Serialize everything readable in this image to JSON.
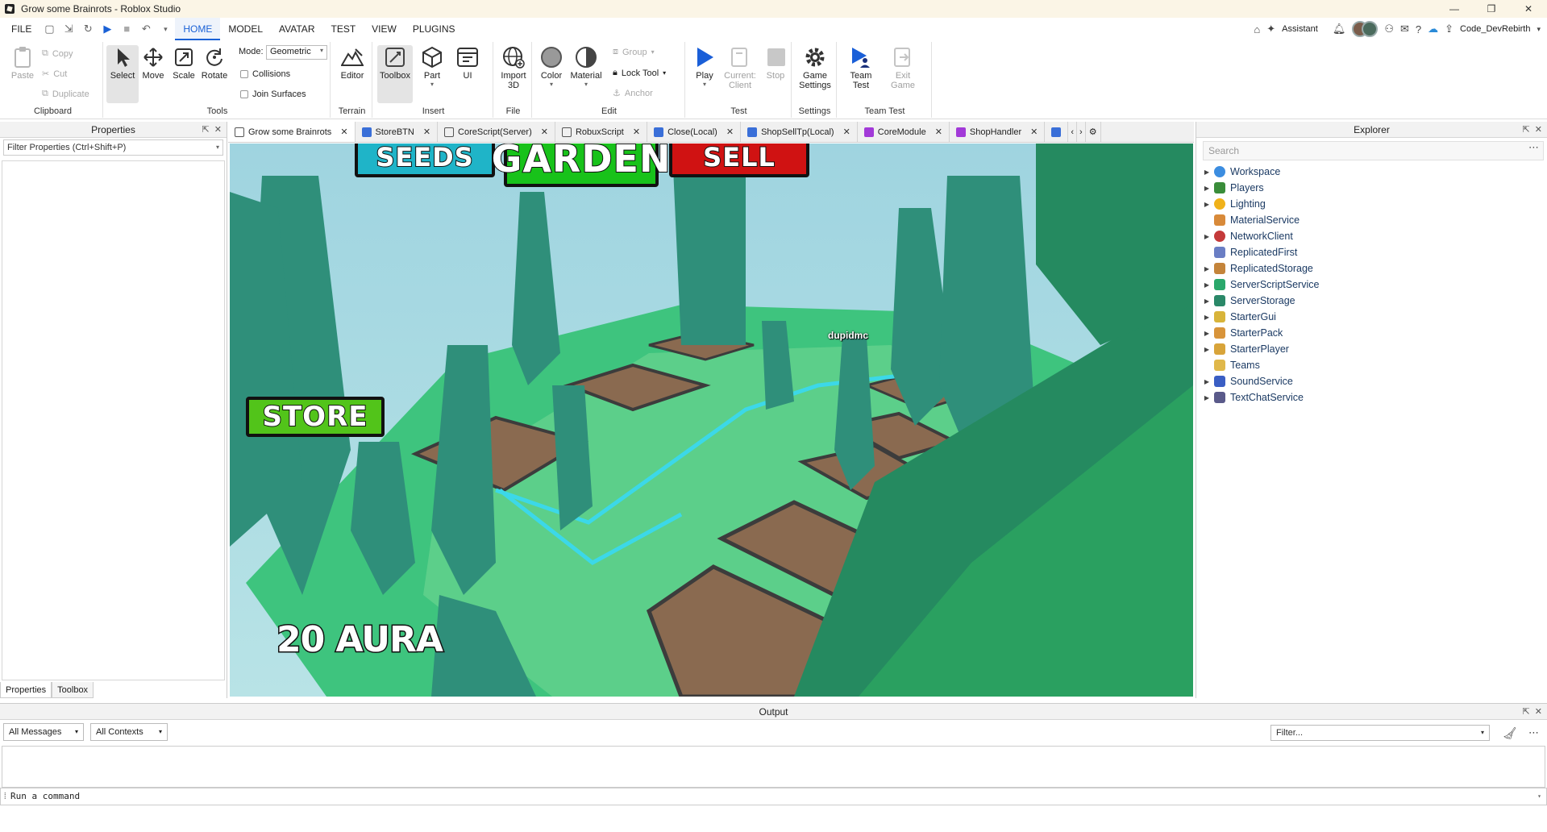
{
  "window": {
    "title": "Grow some Brainrots - Roblox Studio",
    "controls": [
      "—",
      "❐",
      "✕"
    ]
  },
  "menubar": {
    "file": "FILE",
    "tabs": [
      "HOME",
      "MODEL",
      "AVATAR",
      "TEST",
      "VIEW",
      "PLUGINS"
    ],
    "assistant": "Assistant",
    "username": "Code_DevRebirth"
  },
  "ribbon": {
    "clipboard": {
      "label": "Clipboard",
      "paste": "Paste",
      "copy": "Copy",
      "cut": "Cut",
      "duplicate": "Duplicate"
    },
    "tools": {
      "label": "Tools",
      "select": "Select",
      "move": "Move",
      "scale": "Scale",
      "rotate": "Rotate",
      "mode_label": "Mode:",
      "mode_value": "Geometric",
      "collisions": "Collisions",
      "join_surfaces": "Join Surfaces"
    },
    "terrain": {
      "label": "Terrain",
      "editor": "Editor"
    },
    "insert": {
      "label": "Insert",
      "toolbox": "Toolbox",
      "part": "Part",
      "ui": "UI"
    },
    "file": {
      "label": "File",
      "import": "Import",
      "import2": "3D"
    },
    "edit": {
      "label": "Edit",
      "color": "Color",
      "material": "Material",
      "group": "Group",
      "lock_tool": "Lock Tool",
      "anchor": "Anchor"
    },
    "test": {
      "label": "Test",
      "play": "Play",
      "current": "Current:",
      "client": "Client",
      "stop": "Stop"
    },
    "settings": {
      "label": "Settings",
      "game": "Game",
      "settings": "Settings"
    },
    "teamtest": {
      "label": "Team Test",
      "team": "Team",
      "test": "Test",
      "exit": "Exit",
      "game": "Game"
    }
  },
  "properties": {
    "title": "Properties",
    "filter": "Filter Properties (Ctrl+Shift+P)",
    "tab_properties": "Properties",
    "tab_toolbox": "Toolbox"
  },
  "doc_tabs": [
    {
      "label": "Grow some Brainrots",
      "color": "#555555"
    },
    {
      "label": "StoreBTN",
      "color": "#3a6fd8"
    },
    {
      "label": "CoreScript(Server)",
      "color": "#555555"
    },
    {
      "label": "RobuxScript",
      "color": "#555555"
    },
    {
      "label": "Close(Local)",
      "color": "#3a6fd8"
    },
    {
      "label": "ShopSellTp(Local)",
      "color": "#3a6fd8"
    },
    {
      "label": "CoreModule",
      "color": "#a23ad8"
    },
    {
      "label": "ShopHandler",
      "color": "#a23ad8"
    }
  ],
  "game_ui": {
    "seeds": {
      "label": "SEEDS",
      "color": "#1fb4c8"
    },
    "garden": {
      "label": "GARDEN",
      "color": "#18c21a"
    },
    "sell": {
      "label": "SELL",
      "color": "#d01212"
    },
    "store": {
      "label": "STORE",
      "color": "#52c41a"
    },
    "aura": "20 AURA",
    "player_name": "dupidmc"
  },
  "explorer": {
    "title": "Explorer",
    "search_placeholder": "Search",
    "items": [
      {
        "label": "Workspace",
        "icon_color": "#3c8de0",
        "expandable": true
      },
      {
        "label": "Players",
        "icon_color": "#3a8d3a",
        "expandable": true
      },
      {
        "label": "Lighting",
        "icon_color": "#f0b21a",
        "expandable": true
      },
      {
        "label": "MaterialService",
        "icon_color": "#d88a3a",
        "expandable": false
      },
      {
        "label": "NetworkClient",
        "icon_color": "#c43a3a",
        "expandable": true
      },
      {
        "label": "ReplicatedFirst",
        "icon_color": "#6a7ec4",
        "expandable": false
      },
      {
        "label": "ReplicatedStorage",
        "icon_color": "#c4843a",
        "expandable": true
      },
      {
        "label": "ServerScriptService",
        "icon_color": "#2aa86b",
        "expandable": true
      },
      {
        "label": "ServerStorage",
        "icon_color": "#2a8868",
        "expandable": true
      },
      {
        "label": "StarterGui",
        "icon_color": "#d8b43a",
        "expandable": true
      },
      {
        "label": "StarterPack",
        "icon_color": "#d8943a",
        "expandable": true
      },
      {
        "label": "StarterPlayer",
        "icon_color": "#d8a43a",
        "expandable": true
      },
      {
        "label": "Teams",
        "icon_color": "#e0b84a",
        "expandable": false
      },
      {
        "label": "SoundService",
        "icon_color": "#3a5ec4",
        "expandable": true
      },
      {
        "label": "TextChatService",
        "icon_color": "#5a5a8a",
        "expandable": true
      }
    ]
  },
  "output": {
    "title": "Output",
    "messages_filter": "All Messages",
    "contexts_filter": "All Contexts",
    "filter_placeholder": "Filter...",
    "command_placeholder": "Run a command"
  }
}
